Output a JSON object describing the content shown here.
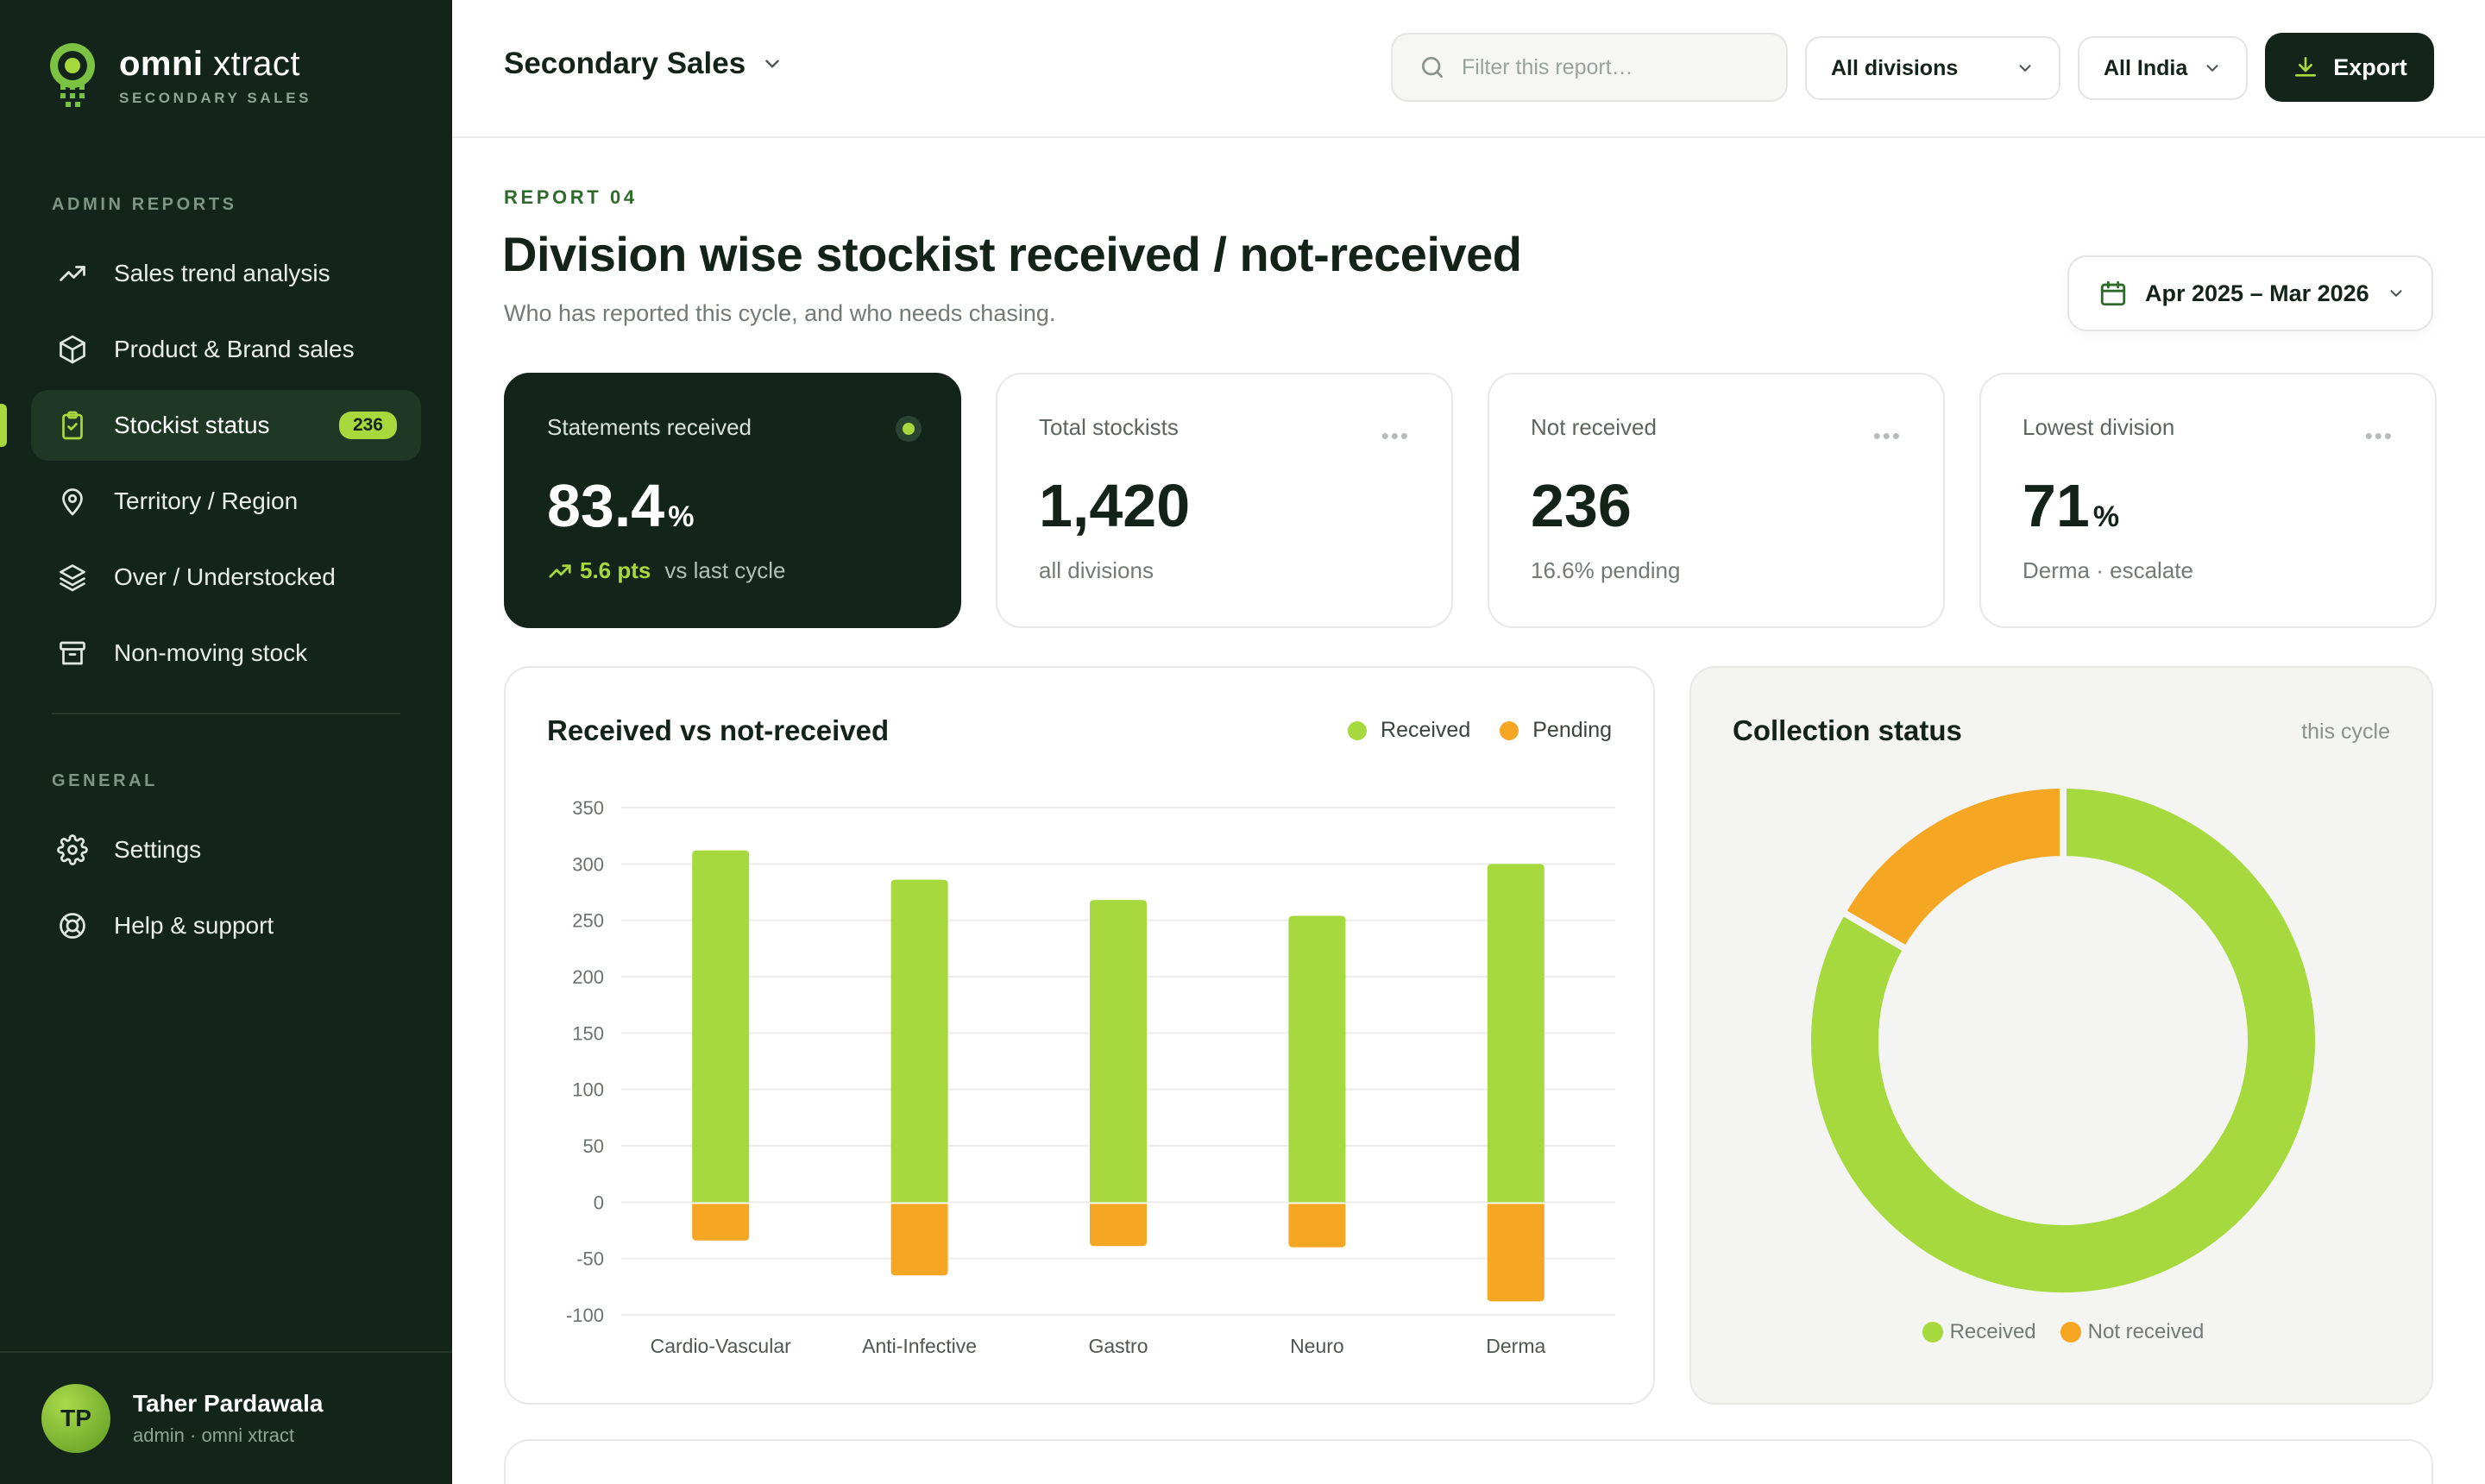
{
  "brand": {
    "name_bold": "omni",
    "name_light": " xtract",
    "subtitle": "SECONDARY SALES"
  },
  "sidebar": {
    "section_admin": "ADMIN REPORTS",
    "section_general": "GENERAL",
    "items": [
      {
        "label": "Sales trend analysis",
        "icon": "trend-up-icon"
      },
      {
        "label": "Product & Brand sales",
        "icon": "box-icon"
      },
      {
        "label": "Stockist status",
        "icon": "clipboard-check-icon",
        "badge": "236",
        "active": true
      },
      {
        "label": "Territory / Region",
        "icon": "map-pin-icon"
      },
      {
        "label": "Over / Understocked",
        "icon": "layers-icon"
      },
      {
        "label": "Non-moving stock",
        "icon": "archive-icon"
      }
    ],
    "general_items": [
      {
        "label": "Settings",
        "icon": "gear-icon"
      },
      {
        "label": "Help & support",
        "icon": "lifebuoy-icon"
      }
    ],
    "user": {
      "initials": "TP",
      "name": "Taher Pardawala",
      "role": "admin · omni xtract"
    }
  },
  "topbar": {
    "report_name": "Secondary Sales",
    "search_placeholder": "Filter this report…",
    "division_select": "All divisions",
    "region_select": "All India",
    "export_label": "Export"
  },
  "header": {
    "eyebrow": "REPORT 04",
    "title": "Division wise stockist received / not-received",
    "subtitle": "Who has reported this cycle, and who needs chasing.",
    "date_range": "Apr 2025 – Mar 2026"
  },
  "kpis": [
    {
      "label": "Statements received",
      "value": "83.4",
      "unit": "%",
      "delta": "5.6 pts",
      "note": "vs last cycle"
    },
    {
      "label": "Total stockists",
      "value": "1,420",
      "unit": "",
      "note": "all divisions"
    },
    {
      "label": "Not received",
      "value": "236",
      "unit": "",
      "note": "16.6% pending"
    },
    {
      "label": "Lowest division",
      "value": "71",
      "unit": "%",
      "note": "Derma · escalate"
    }
  ],
  "colors": {
    "received": "#a6d93d",
    "pending": "#f5a623",
    "dark": "#13251a",
    "accent": "#a7d93c"
  },
  "bar_panel": {
    "title": "Received vs not-received",
    "legend_received": "Received",
    "legend_pending": "Pending"
  },
  "donut_panel": {
    "title": "Collection status",
    "meta": "this cycle",
    "legend_received": "Received",
    "legend_not_received": "Not received"
  },
  "chart_data": [
    {
      "type": "bar",
      "title": "Received vs not-received",
      "categories": [
        "Cardio-Vascular",
        "Anti-Infective",
        "Gastro",
        "Neuro",
        "Derma"
      ],
      "series": [
        {
          "name": "Received",
          "values": [
            312,
            286,
            268,
            254,
            300
          ]
        },
        {
          "name": "Pending",
          "values": [
            -34,
            -65,
            -39,
            -40,
            -88
          ]
        }
      ],
      "yticks": [
        350,
        300,
        250,
        200,
        150,
        100,
        50,
        0,
        -50,
        -100
      ],
      "ylim": [
        -100,
        350
      ],
      "legend_position": "top-right",
      "grid": true
    },
    {
      "type": "pie",
      "title": "Collection status",
      "categories": [
        "Received",
        "Not received"
      ],
      "values": [
        83.4,
        16.6
      ],
      "legend_position": "bottom"
    }
  ]
}
